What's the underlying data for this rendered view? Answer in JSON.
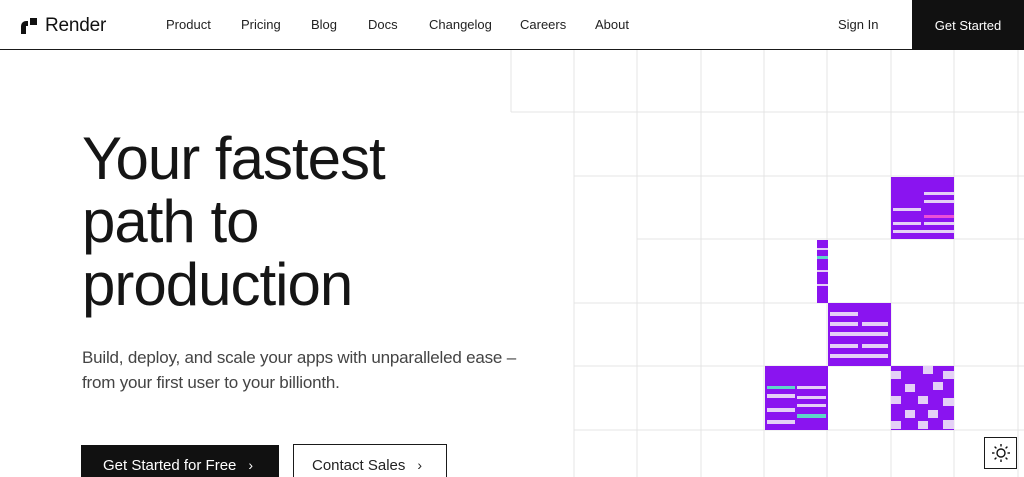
{
  "brand": {
    "name": "Render"
  },
  "nav": {
    "links": [
      "Product",
      "Pricing",
      "Blog",
      "Docs",
      "Changelog",
      "Careers",
      "About"
    ],
    "sign_in": "Sign In",
    "get_started": "Get Started"
  },
  "hero": {
    "title_lines": [
      "Your fastest",
      "path to",
      "production"
    ],
    "subtitle_lines": [
      "Build, deploy, and scale your apps with unparalleled ease –",
      "from your first user to your billionth."
    ],
    "primary_cta": "Get Started for Free",
    "secondary_cta": "Contact Sales"
  },
  "colors": {
    "accent": "#8A14F0",
    "accent_light": "#E4D0F6",
    "accent_pink": "#EC4FD8",
    "accent_cyan": "#5ED6C8",
    "ink": "#111111"
  }
}
